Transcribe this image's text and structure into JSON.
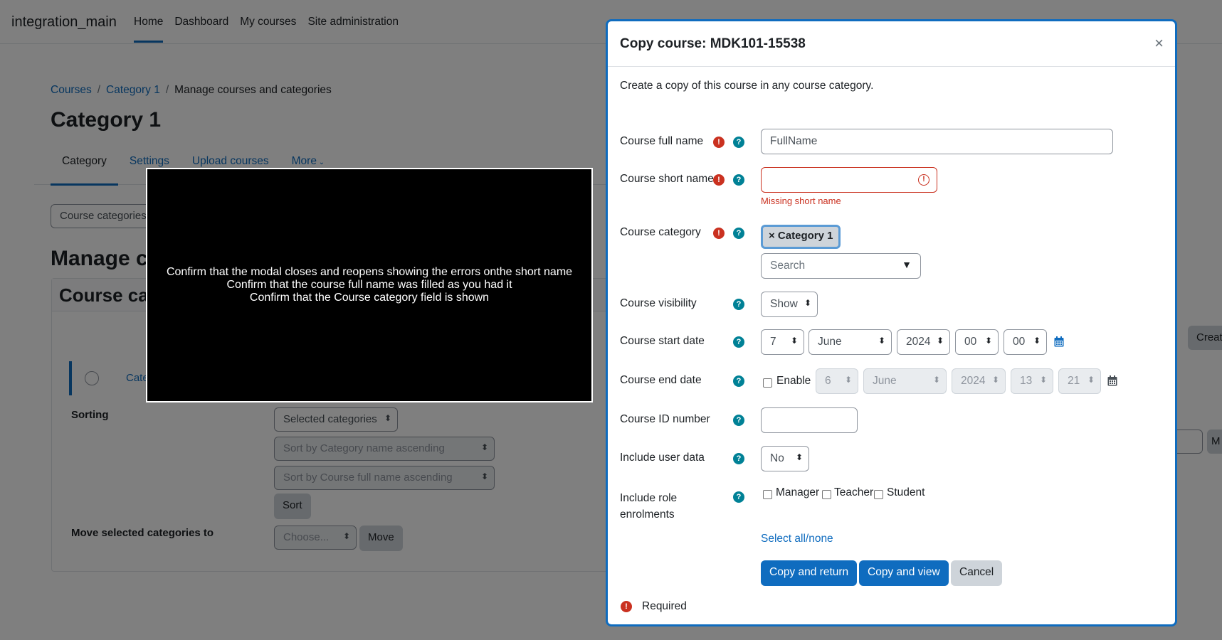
{
  "app": {
    "brand": "integration_main",
    "nav": [
      "Home",
      "Dashboard",
      "My courses",
      "Site administration"
    ]
  },
  "breadcrumb": {
    "b1": "Courses",
    "b2": "Category 1",
    "b3": "Manage courses and categories",
    "sep": "/"
  },
  "page": {
    "title": "Category 1",
    "tabs": [
      "Category",
      "Settings",
      "Upload courses",
      "More"
    ],
    "category_select": "Course categories",
    "manage_title": "Manage c",
    "panel_title": "Course ca",
    "row_label": "Cate",
    "create_btn": "Creat",
    "right_btn": "M"
  },
  "sorting": {
    "label": "Sorting",
    "selected": "Selected categories",
    "sort_cat": "Sort by Category name ascending",
    "sort_course": "Sort by Course full name ascending",
    "sort_btn": "Sort",
    "move_label": "Move selected categories to",
    "choose": "Choose...",
    "move_btn": "Move"
  },
  "note": {
    "line1": "Confirm that the modal closes and reopens showing the errors onthe short name",
    "line2": "Confirm that the course full name was filled as you had it",
    "line3": "Confirm that the Course category field is shown"
  },
  "modal": {
    "title": "Copy course: MDK101-15538",
    "close": "×",
    "intro": "Create a copy of this course in any course category.",
    "full_name_label": "Course full name",
    "full_name_value": "FullName",
    "short_name_label": "Course short name",
    "short_name_value": "",
    "short_name_error": "Missing short name",
    "category_label": "Course category",
    "category_tag": "× Category 1",
    "category_search": "Search",
    "visibility_label": "Course visibility",
    "visibility_value": "Show",
    "start_label": "Course start date",
    "start": {
      "day": "7",
      "month": "June",
      "year": "2024",
      "hour": "00",
      "minute": "00"
    },
    "end_label": "Course end date",
    "end_enable": "Enable",
    "end": {
      "day": "6",
      "month": "June",
      "year": "2024",
      "hour": "13",
      "minute": "21"
    },
    "idnumber_label": "Course ID number",
    "userdata_label": "Include user data",
    "userdata_value": "No",
    "roles_label_1": "Include role",
    "roles_label_2": "enrolments",
    "roles": [
      "Manager",
      "Teacher",
      "Student"
    ],
    "select_all": "Select all/none",
    "btn_copy_return": "Copy and return",
    "btn_copy_view": "Copy and view",
    "btn_cancel": "Cancel",
    "required": "Required",
    "req_mark": "!",
    "help_mark": "?"
  },
  "colors": {
    "primary": "#0f6cbf",
    "danger": "#ca3120",
    "help": "#008196"
  }
}
